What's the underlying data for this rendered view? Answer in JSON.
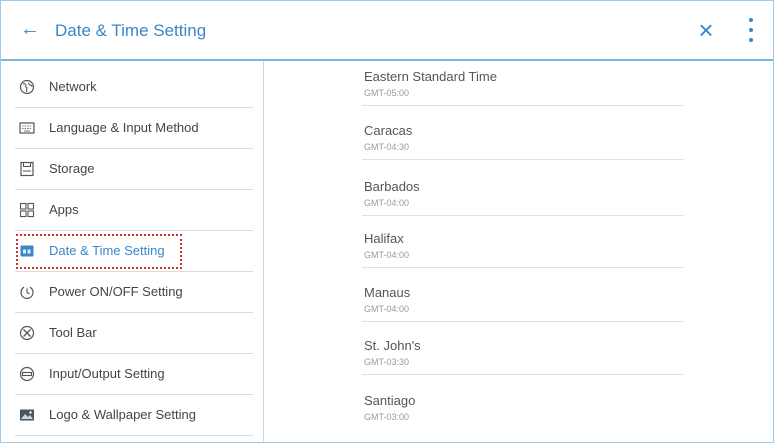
{
  "header": {
    "title": "Date & Time Setting",
    "back_icon": "arrow-left-icon",
    "close_icon": "close-icon",
    "more_icon": "more-vertical-icon"
  },
  "sidebar": {
    "items": [
      {
        "label": "Network",
        "icon": "globe-icon"
      },
      {
        "label": "Language & Input Method",
        "icon": "keyboard-icon"
      },
      {
        "label": "Storage",
        "icon": "storage-icon"
      },
      {
        "label": "Apps",
        "icon": "apps-grid-icon"
      },
      {
        "label": "Date & Time Setting",
        "icon": "calendar-icon",
        "active": true
      },
      {
        "label": "Power ON/OFF Setting",
        "icon": "power-timer-icon"
      },
      {
        "label": "Tool Bar",
        "icon": "tools-icon"
      },
      {
        "label": "Input/Output Setting",
        "icon": "input-output-icon"
      },
      {
        "label": "Logo & Wallpaper Setting",
        "icon": "image-icon"
      }
    ]
  },
  "timezones": [
    {
      "name": "Eastern Standard Time",
      "offset": "GMT-05:00"
    },
    {
      "name": "Caracas",
      "offset": "GMT-04:30"
    },
    {
      "name": "Barbados",
      "offset": "GMT-04:00"
    },
    {
      "name": "Halifax",
      "offset": "GMT-04:00"
    },
    {
      "name": "Manaus",
      "offset": "GMT-04:00"
    },
    {
      "name": "St. John's",
      "offset": "GMT-03:30"
    },
    {
      "name": "Santiago",
      "offset": "GMT-03:00"
    }
  ],
  "colors": {
    "accent": "#3a86c8",
    "highlight_box": "#d23030"
  }
}
